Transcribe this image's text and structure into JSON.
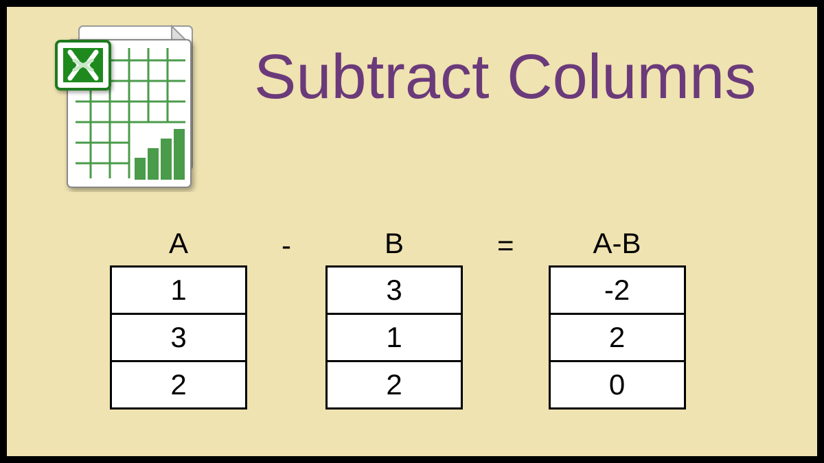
{
  "title": "Subtract Columns",
  "columns": {
    "a": {
      "header": "A",
      "values": [
        "1",
        "3",
        "2"
      ]
    },
    "b": {
      "header": "B",
      "values": [
        "3",
        "1",
        "2"
      ]
    },
    "result": {
      "header": "A-B",
      "values": [
        "-2",
        "2",
        "0"
      ]
    }
  },
  "operators": {
    "minus": "-",
    "equals": "="
  },
  "colors": {
    "title": "#6b3a7a",
    "background": "#efe3b1",
    "border": "#000000",
    "cellBg": "#ffffff"
  }
}
